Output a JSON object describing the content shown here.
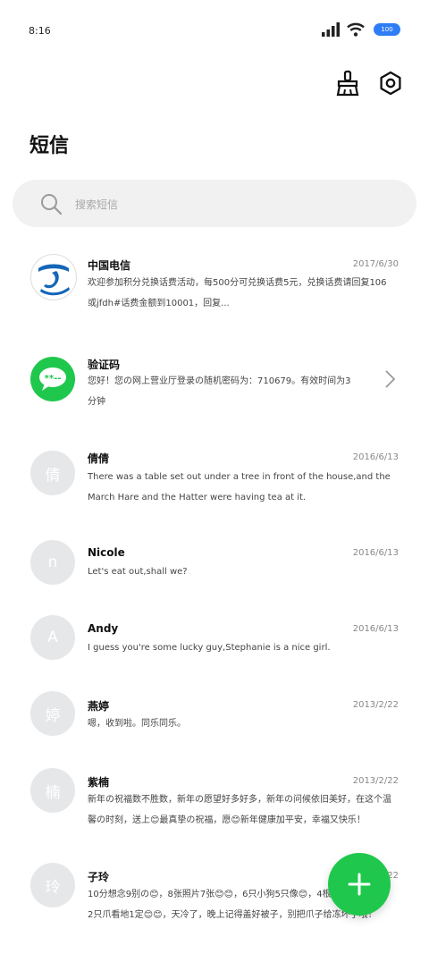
{
  "status": {
    "time": "8:16",
    "battery": "100"
  },
  "colors": {
    "accent": "#1fc84c",
    "telecom_blue": "#1466b8",
    "battery_blue": "#2f7df6"
  },
  "toolbar": {
    "clean_icon": "broom-icon",
    "settings_icon": "gear-hex-icon"
  },
  "page": {
    "title": "短信"
  },
  "search": {
    "placeholder": "搜索短信"
  },
  "messages": [
    {
      "name": "中国电信",
      "date": "2017/6/30",
      "avatar": "",
      "avatar_kind": "telecom-logo",
      "preview": "欢迎参加积分兑换话费活动，每500分可兑换话费5元，兑换话费请回复106或jfdh#话费金额到10001，回复..."
    },
    {
      "name": "验证码",
      "date": "",
      "avatar": "",
      "avatar_kind": "sms-bubble",
      "preview": "您好！您の网上营业厅登录の随机密码为：710679。有效时间为3分钟"
    },
    {
      "name": "倩倩",
      "date": "2016/6/13",
      "avatar": "倩",
      "preview": "There was a table set out under a tree in front of the house,and the March Hare and the Hatter were having tea at it."
    },
    {
      "name": "Nicole",
      "date": "2016/6/13",
      "avatar": "n",
      "preview": "Let's eat out,shall we?"
    },
    {
      "name": "Andy",
      "date": "2016/6/13",
      "avatar": "A",
      "preview": "I guess you're some lucky guy,Stephanie is a nice girl."
    },
    {
      "name": "燕婷",
      "date": "2013/2/22",
      "avatar": "婷",
      "preview": "嗯，收到啦。同乐同乐。"
    },
    {
      "name": "紫楠",
      "date": "2013/2/22",
      "avatar": "楠",
      "preview": "新年の祝福数不胜数，新年の愿望好多好多，新年の问候依旧美好，在这个温馨の时刻，送上😊最真挚の祝福，愿😊新年健康加平安，幸福又快乐！"
    },
    {
      "name": "子玲",
      "date": "2013/2/22",
      "avatar": "玲",
      "preview": "10分想念9别の😊，8张照片7张😊😊，6只小狗5只像😊，4根骨头3根😊😊，2只爪看地1定😊😊，天冷了，晚上记得盖好被子，别把爪子给冻坏了哦！"
    }
  ]
}
